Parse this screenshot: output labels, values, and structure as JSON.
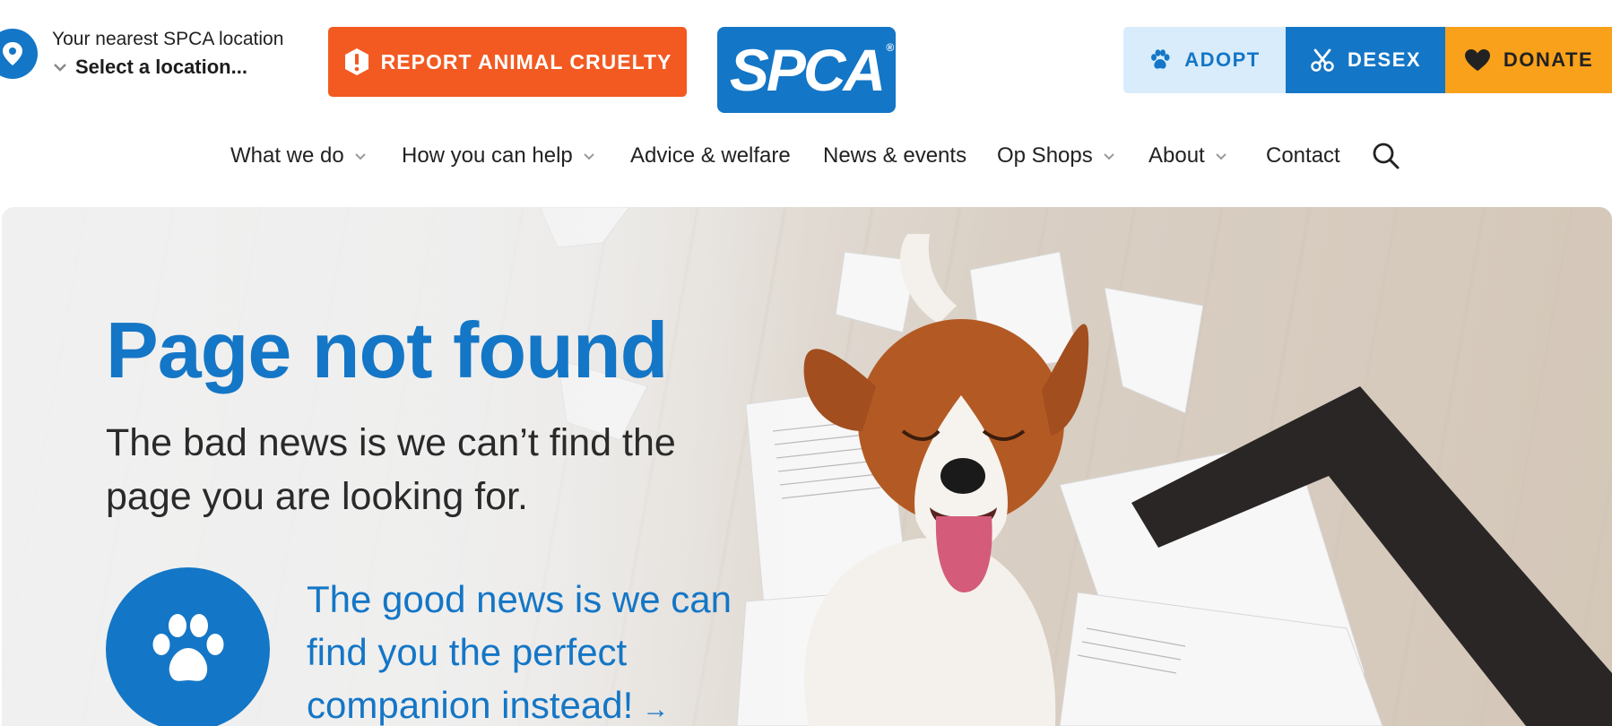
{
  "location": {
    "label": "Your nearest SPCA location",
    "selected": "Select a location..."
  },
  "header": {
    "report_label": "REPORT ANIMAL CRUELTY",
    "logo_text": "SPCA",
    "logo_mark": "®"
  },
  "cta": {
    "adopt": "ADOPT",
    "desex": "DESEX",
    "donate": "DONATE"
  },
  "nav": {
    "items": [
      {
        "label": "What we do",
        "dropdown": true
      },
      {
        "label": "How you can help",
        "dropdown": true
      },
      {
        "label": "Advice & welfare",
        "dropdown": false
      },
      {
        "label": "News & events",
        "dropdown": false
      },
      {
        "label": "Op Shops",
        "dropdown": true
      },
      {
        "label": "About",
        "dropdown": true
      },
      {
        "label": "Contact",
        "dropdown": false
      }
    ]
  },
  "hero": {
    "title": "Page not found",
    "subtitle": "The bad news is we can’t find the page you are looking for.",
    "good_news": "The good news is we can find you the perfect companion instead!",
    "arrow": "→"
  },
  "colors": {
    "brand_blue": "#1476c6",
    "report_orange": "#f25a22",
    "donate_yellow": "#f9a11b",
    "adopt_bg": "#d9ecfb"
  },
  "icons": {
    "location": "map-pin-icon",
    "report": "alert-shield-icon",
    "adopt": "paw-icon",
    "desex": "scissors-icon",
    "donate": "heart-icon",
    "search": "search-icon",
    "hero_circle": "paw-icon"
  }
}
